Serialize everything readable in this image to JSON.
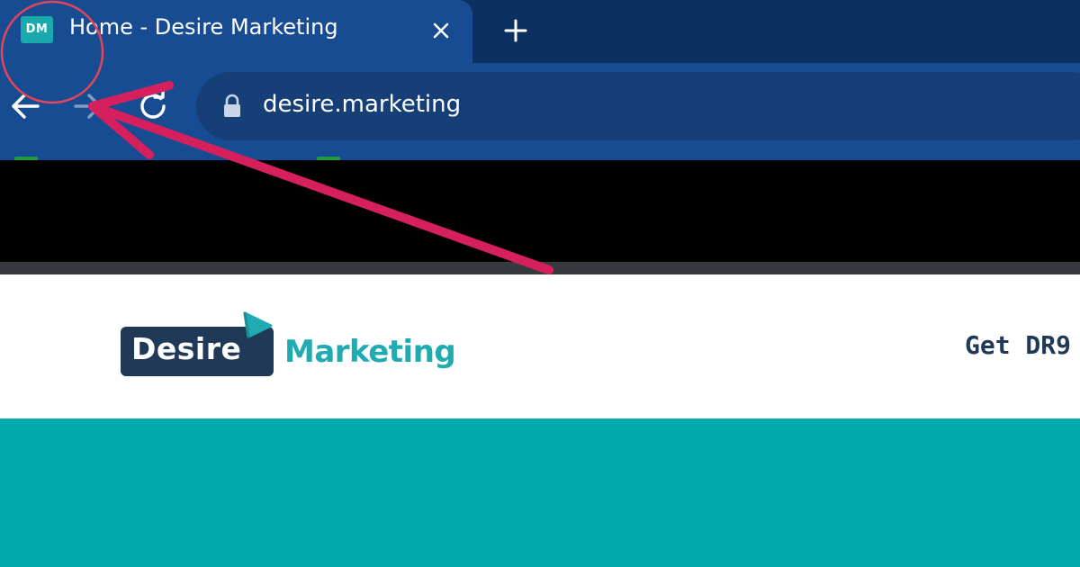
{
  "browser": {
    "tab": {
      "favicon_text": "DM",
      "title": "Home - Desire Marketing"
    },
    "url": "desire.marketing",
    "icons": {
      "close": "close-icon",
      "new_tab": "plus-icon",
      "back": "arrow-left-icon",
      "forward": "arrow-right-icon",
      "reload": "reload-icon",
      "lock": "lock-icon"
    }
  },
  "site": {
    "logo": {
      "word1": "Desire",
      "word2": "Marketing"
    },
    "nav_partial": "Get DR9"
  },
  "colors": {
    "tab_strip": "#0b3160",
    "toolbar": "#184c92",
    "logo_dark": "#1f3957",
    "accent_teal": "#00a9ab",
    "annotation": "#d6205e"
  }
}
